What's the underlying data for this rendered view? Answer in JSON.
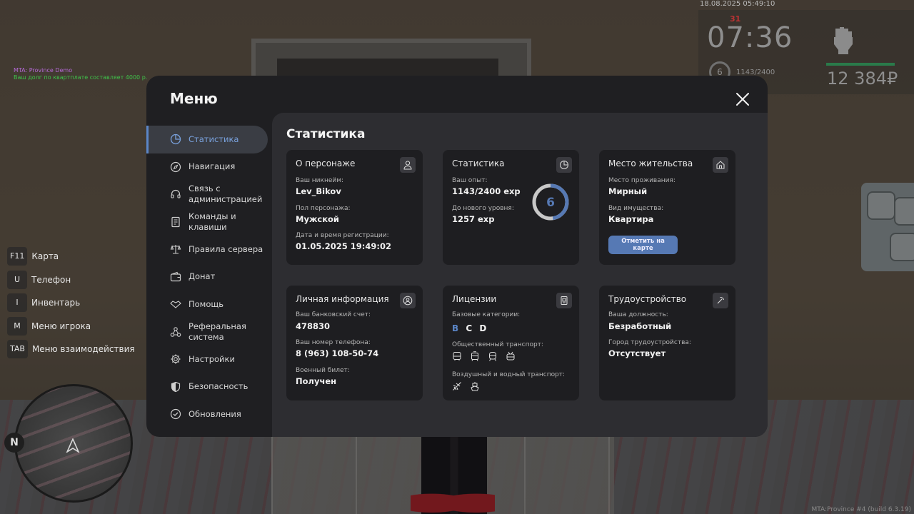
{
  "hud": {
    "datetime": "18.08.2025 05:49:10",
    "red_mark": "31",
    "time": "07:36",
    "level": "6",
    "xp": "1143/2400",
    "money": "12 384₽"
  },
  "chat": [
    {
      "text": "MTA: Province Demo",
      "color": "#b66ad8"
    },
    {
      "text": "Ваш долг по квартплате составляет 4000 р.",
      "color": "#3fc24a"
    }
  ],
  "hotkeys": [
    {
      "key": "F11",
      "label": "Карта"
    },
    {
      "key": "U",
      "label": "Телефон"
    },
    {
      "key": "I",
      "label": "Инвентарь"
    },
    {
      "key": "M",
      "label": "Меню игрока"
    },
    {
      "key": "TAB",
      "label": "Меню взаимодействия"
    }
  ],
  "minimap": {
    "north": "N"
  },
  "build": "MTA:Province #4 (build 6.3.19)",
  "menu": {
    "title": "Меню",
    "sidebar": [
      {
        "label": "Статистика",
        "icon": "chart-pie-icon",
        "active": true
      },
      {
        "label": "Навигация",
        "icon": "compass-icon"
      },
      {
        "label": "Связь с\nадминистрацией",
        "icon": "headset-icon"
      },
      {
        "label": "Команды и\nклавиши",
        "icon": "document-icon"
      },
      {
        "label": "Правила сервера",
        "icon": "scales-icon"
      },
      {
        "label": "Донат",
        "icon": "wallet-icon"
      },
      {
        "label": "Помощь",
        "icon": "handshake-icon"
      },
      {
        "label": "Реферальная\nсистема",
        "icon": "network-icon"
      },
      {
        "label": "Настройки",
        "icon": "gear-icon"
      },
      {
        "label": "Безопасность",
        "icon": "shield-icon"
      },
      {
        "label": "Обновления",
        "icon": "update-icon"
      }
    ],
    "content_title": "Статистика",
    "character": {
      "title": "О персонаже",
      "nick_label": "Ваш никнейм:",
      "nick": "Lev_Bikov",
      "gender_label": "Пол персонажа:",
      "gender": "Мужской",
      "reg_label": "Дата и время регистрации:",
      "reg": "01.05.2025 19:49:02"
    },
    "stats": {
      "title": "Статистика",
      "exp_label": "Ваш опыт:",
      "exp": "1143/2400 exp",
      "next_label": "До нового уровня:",
      "next": "1257 exp",
      "level": "6",
      "progress": 0.476
    },
    "residence": {
      "title": "Место жительства",
      "place_label": "Место проживания:",
      "place": "Мирный",
      "type_label": "Вид имущества:",
      "type": "Квартира",
      "button": "Отметить на карте"
    },
    "personal": {
      "title": "Личная информация",
      "bank_label": "Ваш банковский счет:",
      "bank": "478830",
      "phone_label": "Ваш номер телефона:",
      "phone": "8 (963) 108-50-74",
      "military_label": "Военный билет:",
      "military": "Получен"
    },
    "licenses": {
      "title": "Лицензии",
      "base_label": "Базовые категории:",
      "categories": [
        {
          "letter": "B",
          "color": "#5b86c8"
        },
        {
          "letter": "C",
          "color": "#f2f2f2"
        },
        {
          "letter": "D",
          "color": "#f2f2f2"
        }
      ],
      "public_label": "Общественный транспорт:",
      "public_icons": [
        "bus-icon",
        "tram-icon",
        "train-icon",
        "trolleybus-icon"
      ],
      "air_label": "Воздушный и водный транспорт:",
      "air_icons": [
        "plane-icon",
        "ship-icon"
      ]
    },
    "employment": {
      "title": "Трудоустройство",
      "position_label": "Ваша должность:",
      "position": "Безработный",
      "city_label": "Город трудоустройства:",
      "city": "Отсутствует"
    }
  }
}
